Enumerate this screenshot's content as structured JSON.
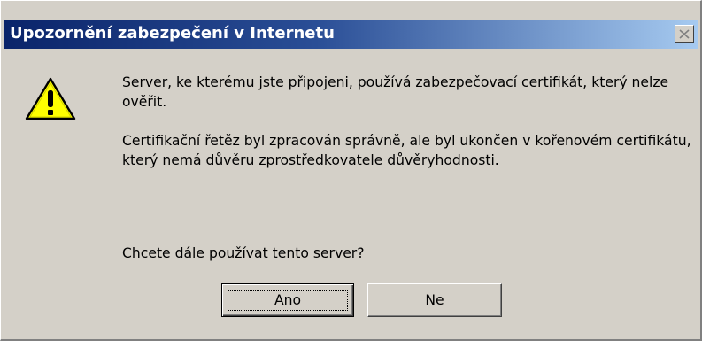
{
  "window": {
    "title": "Upozornění zabezpečení v Internetu",
    "close_icon": "close-x-icon"
  },
  "icon": {
    "name": "warning-icon",
    "color": "#ffff00"
  },
  "message": {
    "paragraph1": "Server, ke kterému jste připojeni, používá zabezpečovací certifikát, který nelze ověřit.",
    "paragraph2": "Certifikační řetěz byl zpracován správně, ale byl ukončen v kořenovém certifikátu, který nemá důvěru zprostředkovatele důvěryhodnosti.",
    "question": "Chcete dále používat tento server?"
  },
  "buttons": {
    "yes_label": "Ano",
    "no_label": "Ne"
  }
}
